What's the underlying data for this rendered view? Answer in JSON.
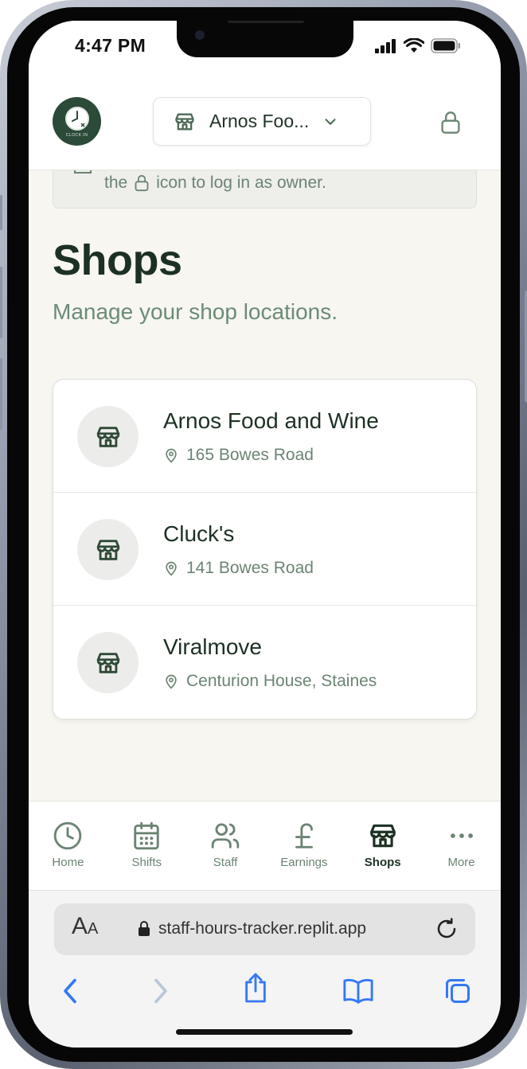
{
  "status_bar": {
    "time": "4:47 PM"
  },
  "header": {
    "logo_text": "CLOCK IN",
    "selected_shop": "Arnos Foo...",
    "chevron_icon": "chevron-down-icon",
    "lock_icon": "lock-icon"
  },
  "banner": {
    "text_before": "the",
    "text_after": "icon to log in as owner."
  },
  "page": {
    "title": "Shops",
    "subtitle": "Manage your shop locations."
  },
  "shops": [
    {
      "name": "Arnos Food and Wine",
      "address": "165 Bowes Road"
    },
    {
      "name": "Cluck's",
      "address": "141 Bowes Road"
    },
    {
      "name": "Viralmove",
      "address": "Centurion House, Staines"
    }
  ],
  "bottom_nav": {
    "items": [
      {
        "label": "Home",
        "icon": "clock-icon"
      },
      {
        "label": "Shifts",
        "icon": "calendar-icon"
      },
      {
        "label": "Staff",
        "icon": "users-icon"
      },
      {
        "label": "Earnings",
        "icon": "pound-icon"
      },
      {
        "label": "Shops",
        "icon": "store-icon",
        "active": true
      },
      {
        "label": "More",
        "icon": "more-icon"
      }
    ]
  },
  "browser": {
    "aa_large": "A",
    "aa_small": "A",
    "url": "staff-hours-tracker.replit.app"
  },
  "colors": {
    "brand_dark": "#1c3123",
    "brand_muted": "#6b8473",
    "page_bg": "#f7f6f1",
    "logo_bg": "#2b4a38",
    "safari_blue": "#3478f6"
  }
}
